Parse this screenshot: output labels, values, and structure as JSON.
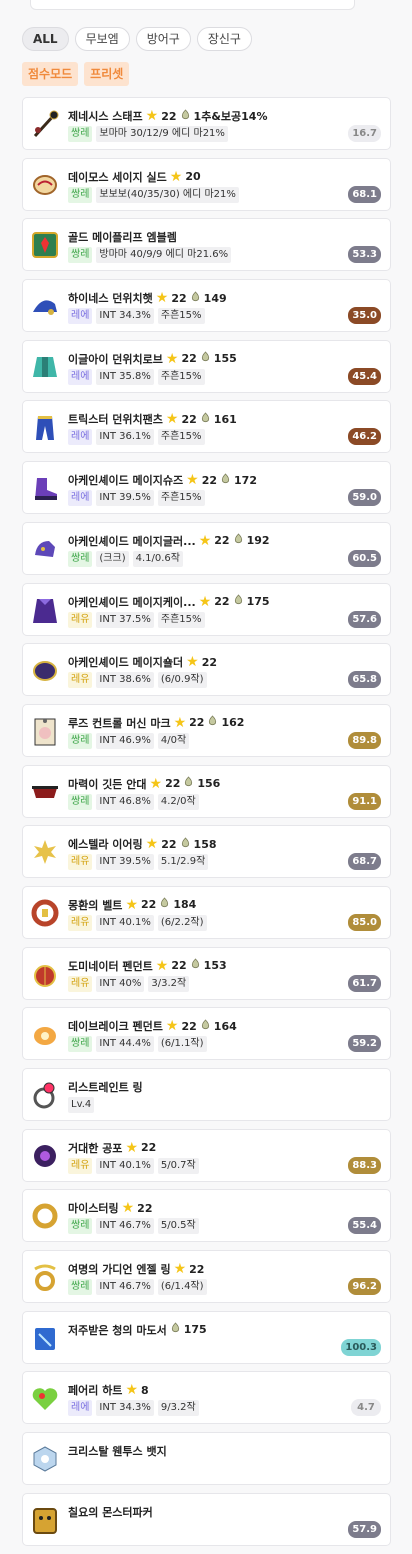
{
  "filters": {
    "tabs": [
      "ALL",
      "무보엠",
      "방어구",
      "장신구"
    ],
    "modes": [
      "점수모드",
      "프리셋"
    ]
  },
  "items": [
    {
      "icon": "staff-icon",
      "name": "제네시스 스태프",
      "star": "22",
      "flame": "1추&보공14%",
      "pot": "쌍레",
      "pot_color": "green",
      "stats": [
        "보마마 30/12/9 에디 마21%"
      ],
      "score": "16.7",
      "score_color": "#ececf0",
      "score_text": "#888"
    },
    {
      "icon": "shield-icon",
      "name": "데이모스 세이지 실드",
      "star": "20",
      "flame": "",
      "pot": "쌍레",
      "pot_color": "green",
      "stats": [
        "보보보(40/35/30) 에디 마21%"
      ],
      "score": "68.1",
      "score_color": "#7d7c8c",
      "score_text": "#fff"
    },
    {
      "icon": "emblem-icon",
      "name": "골드 메이플리프 엠블렘",
      "star": "",
      "flame": "",
      "pot": "쌍레",
      "pot_color": "green",
      "stats": [
        "방마마 40/9/9 에디 마21.6%"
      ],
      "score": "53.3",
      "score_color": "#7d7c8c",
      "score_text": "#fff"
    },
    {
      "icon": "hat-icon",
      "name": "하이네스 던위치햇",
      "star": "22",
      "flame": "149",
      "pot": "레에",
      "pot_color": "purple",
      "stats": [
        "INT 34.3%",
        "주흔15%"
      ],
      "score": "35.0",
      "score_color": "#8b4a26",
      "score_text": "#fff"
    },
    {
      "icon": "robe-icon",
      "name": "이글아이 던위치로브",
      "star": "22",
      "flame": "155",
      "pot": "레에",
      "pot_color": "purple",
      "stats": [
        "INT 35.8%",
        "주흔15%"
      ],
      "score": "45.4",
      "score_color": "#8b4a26",
      "score_text": "#fff"
    },
    {
      "icon": "pants-icon",
      "name": "트릭스터 던위치팬츠",
      "star": "22",
      "flame": "161",
      "pot": "레에",
      "pot_color": "purple",
      "stats": [
        "INT 36.1%",
        "주흔15%"
      ],
      "score": "46.2",
      "score_color": "#8b4a26",
      "score_text": "#fff"
    },
    {
      "icon": "shoes-icon",
      "name": "아케인셰이드 메이지슈즈",
      "star": "22",
      "flame": "172",
      "pot": "레에",
      "pot_color": "purple",
      "stats": [
        "INT 39.5%",
        "주흔15%"
      ],
      "score": "59.0",
      "score_color": "#7d7c8c",
      "score_text": "#fff"
    },
    {
      "icon": "gloves-icon",
      "name": "아케인셰이드 메이지글러...",
      "star": "22",
      "flame": "192",
      "pot": "쌍레",
      "pot_color": "green",
      "stats": [
        "(크크)",
        "4.1/0.6작"
      ],
      "score": "60.5",
      "score_color": "#7d7c8c",
      "score_text": "#fff"
    },
    {
      "icon": "cape-icon",
      "name": "아케인셰이드 메이지케이...",
      "star": "22",
      "flame": "175",
      "pot": "레유",
      "pot_color": "yellow",
      "stats": [
        "INT 37.5%",
        "주흔15%"
      ],
      "score": "57.6",
      "score_color": "#7d7c8c",
      "score_text": "#fff"
    },
    {
      "icon": "shoulder-icon",
      "name": "아케인셰이드 메이지숄더",
      "star": "22",
      "flame": "",
      "pot": "레유",
      "pot_color": "yellow",
      "stats": [
        "INT 38.6%",
        "(6/0.9작)"
      ],
      "score": "65.8",
      "score_color": "#7d7c8c",
      "score_text": "#fff"
    },
    {
      "icon": "badge-card-icon",
      "name": "루즈 컨트롤 머신 마크",
      "star": "22",
      "flame": "162",
      "pot": "쌍레",
      "pot_color": "green",
      "stats": [
        "INT 46.9%",
        "4/0작"
      ],
      "score": "89.8",
      "score_color": "#b08d3a",
      "score_text": "#fff"
    },
    {
      "icon": "eyepatch-icon",
      "name": "마력이 깃든 안대",
      "star": "22",
      "flame": "156",
      "pot": "쌍레",
      "pot_color": "green",
      "stats": [
        "INT 46.8%",
        "4.2/0작"
      ],
      "score": "91.1",
      "score_color": "#b08d3a",
      "score_text": "#fff"
    },
    {
      "icon": "earring-icon",
      "name": "에스텔라 이어링",
      "star": "22",
      "flame": "158",
      "pot": "레유",
      "pot_color": "yellow",
      "stats": [
        "INT 39.5%",
        "5.1/2.9작"
      ],
      "score": "68.7",
      "score_color": "#7d7c8c",
      "score_text": "#fff"
    },
    {
      "icon": "belt-icon",
      "name": "몽환의 벨트",
      "star": "22",
      "flame": "184",
      "pot": "레유",
      "pot_color": "yellow",
      "stats": [
        "INT 40.1%",
        "(6/2.2작)"
      ],
      "score": "85.0",
      "score_color": "#b08d3a",
      "score_text": "#fff"
    },
    {
      "icon": "pendant-icon",
      "name": "도미네이터 펜던트",
      "star": "22",
      "flame": "153",
      "pot": "레유",
      "pot_color": "yellow",
      "stats": [
        "INT 40%",
        "3/3.2작"
      ],
      "score": "61.7",
      "score_color": "#7d7c8c",
      "score_text": "#fff"
    },
    {
      "icon": "pendant2-icon",
      "name": "데이브레이크 펜던트",
      "star": "22",
      "flame": "164",
      "pot": "쌍레",
      "pot_color": "green",
      "stats": [
        "INT 44.4%",
        "(6/1.1작)"
      ],
      "score": "59.2",
      "score_color": "#7d7c8c",
      "score_text": "#fff"
    },
    {
      "icon": "ring-icon",
      "name": "리스트레인트 링",
      "star": "",
      "flame": "",
      "pot": "",
      "pot_color": "",
      "stats": [
        "Lv.4"
      ],
      "score": "",
      "score_color": "",
      "score_text": ""
    },
    {
      "icon": "ring-dark-icon",
      "name": "거대한 공포",
      "star": "22",
      "flame": "",
      "pot": "레유",
      "pot_color": "yellow",
      "stats": [
        "INT 40.1%",
        "5/0.7작"
      ],
      "score": "88.3",
      "score_color": "#b08d3a",
      "score_text": "#fff"
    },
    {
      "icon": "ring-gold-icon",
      "name": "마이스터링",
      "star": "22",
      "flame": "",
      "pot": "쌍레",
      "pot_color": "green",
      "stats": [
        "INT 46.7%",
        "5/0.5작"
      ],
      "score": "55.4",
      "score_color": "#7d7c8c",
      "score_text": "#fff"
    },
    {
      "icon": "ring-angel-icon",
      "name": "여명의 가디언 엔젤 링",
      "star": "22",
      "flame": "",
      "pot": "쌍레",
      "pot_color": "green",
      "stats": [
        "INT 46.7%",
        "(6/1.4작)"
      ],
      "score": "96.2",
      "score_color": "#b08d3a",
      "score_text": "#fff"
    },
    {
      "icon": "book-icon",
      "name": "저주받은 청의 마도서",
      "star": "",
      "flame": "175",
      "pot": "",
      "pot_color": "",
      "stats": [],
      "score": "100.3",
      "score_color": "#7fd4d4",
      "score_text": "#2a5a5a"
    },
    {
      "icon": "heart-icon",
      "name": "페어리 하트",
      "star": "8",
      "flame": "",
      "pot": "레에",
      "pot_color": "purple",
      "stats": [
        "INT 34.3%",
        "9/3.2작"
      ],
      "score": "4.7",
      "score_color": "#ececf0",
      "score_text": "#888"
    },
    {
      "icon": "badge-icon",
      "name": "크리스탈 웬투스 뱃지",
      "star": "",
      "flame": "",
      "pot": "",
      "pot_color": "",
      "stats": [],
      "score": "",
      "score_color": "",
      "score_text": ""
    },
    {
      "icon": "pocket-icon",
      "name": "칠요의 몬스터파커",
      "star": "",
      "flame": "",
      "pot": "",
      "pot_color": "",
      "stats": [],
      "score": "57.9",
      "score_color": "#7d7c8c",
      "score_text": "#fff"
    }
  ]
}
